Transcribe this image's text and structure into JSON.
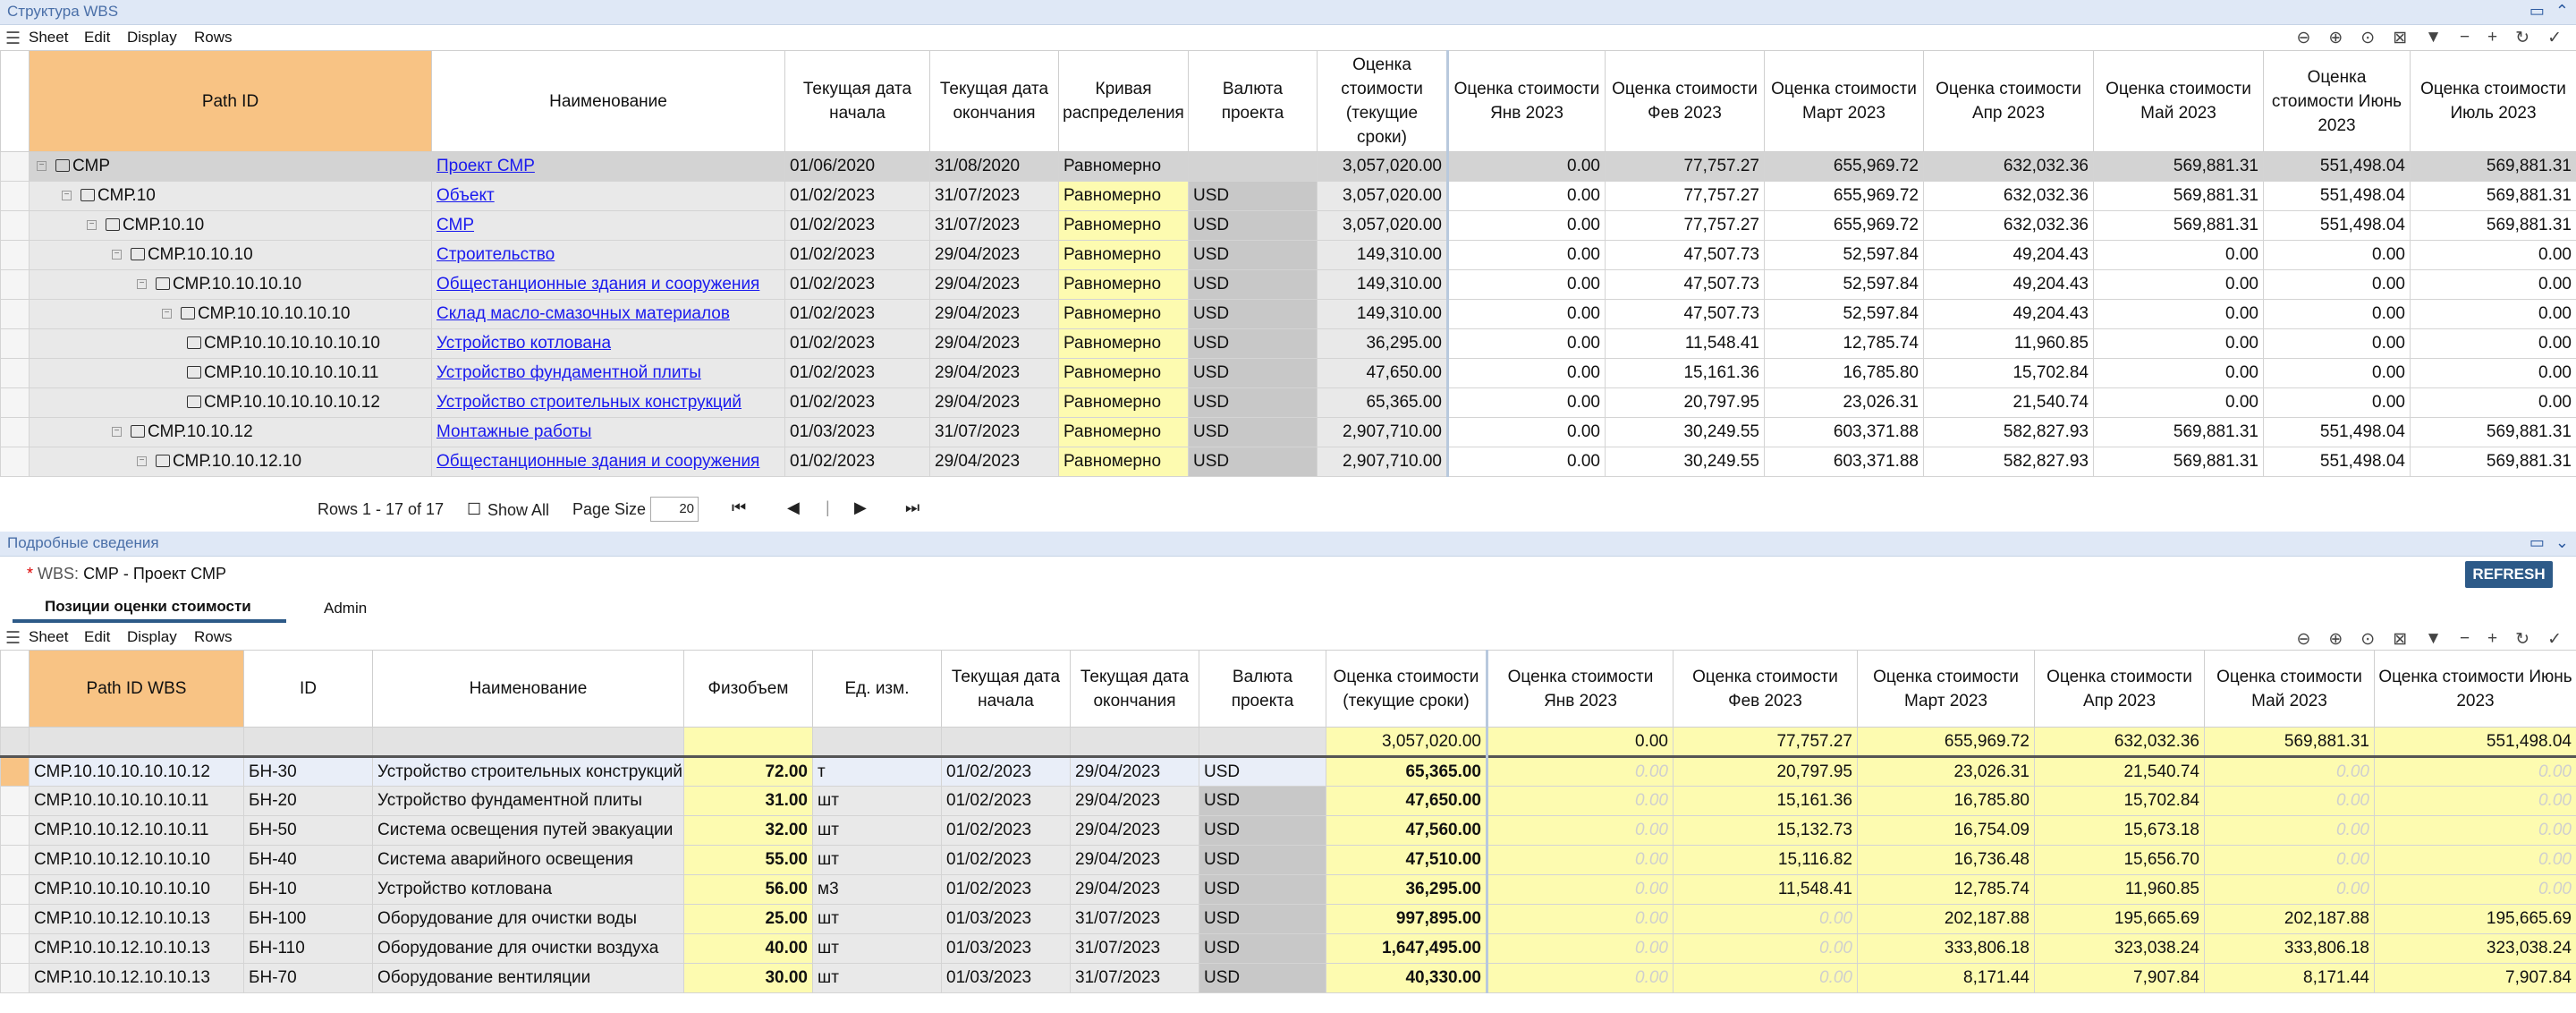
{
  "top_panel": {
    "title": "Структура WBS"
  },
  "menu": {
    "sheet": "Sheet",
    "edit": "Edit",
    "display": "Display",
    "rows": "Rows"
  },
  "top_grid": {
    "headers": [
      "Path ID",
      "Наименование",
      "Текущая дата начала",
      "Текущая дата окончания",
      "Кривая распределения",
      "Валюта проекта",
      "Оценка стоимости (текущие сроки)",
      "Оценка стоимости Янв 2023",
      "Оценка стоимости Фев 2023",
      "Оценка стоимости Март 2023",
      "Оценка стоимости Апр 2023",
      "Оценка стоимости Май 2023",
      "Оценка стоимости Июнь 2023",
      "Оценка стоимости Июль 2023"
    ],
    "rows": [
      {
        "path": "СМР",
        "name": "Проект СМР",
        "start": "01/06/2020",
        "end": "31/08/2020",
        "curve": "Равномерно",
        "cur": "",
        "total": "3,057,020.00",
        "m1": "0.00",
        "m2": "77,757.27",
        "m3": "655,969.72",
        "m4": "632,032.36",
        "m5": "569,881.31",
        "m6": "551,498.04",
        "m7": "569,881.31"
      },
      {
        "path": "СМР.10",
        "name": "Объект",
        "start": "01/02/2023",
        "end": "31/07/2023",
        "curve": "Равномерно",
        "cur": "USD",
        "total": "3,057,020.00",
        "m1": "0.00",
        "m2": "77,757.27",
        "m3": "655,969.72",
        "m4": "632,032.36",
        "m5": "569,881.31",
        "m6": "551,498.04",
        "m7": "569,881.31"
      },
      {
        "path": "СМР.10.10",
        "name": "СМР",
        "start": "01/02/2023",
        "end": "31/07/2023",
        "curve": "Равномерно",
        "cur": "USD",
        "total": "3,057,020.00",
        "m1": "0.00",
        "m2": "77,757.27",
        "m3": "655,969.72",
        "m4": "632,032.36",
        "m5": "569,881.31",
        "m6": "551,498.04",
        "m7": "569,881.31"
      },
      {
        "path": "СМР.10.10.10",
        "name": "Строительство",
        "start": "01/02/2023",
        "end": "29/04/2023",
        "curve": "Равномерно",
        "cur": "USD",
        "total": "149,310.00",
        "m1": "0.00",
        "m2": "47,507.73",
        "m3": "52,597.84",
        "m4": "49,204.43",
        "m5": "0.00",
        "m6": "0.00",
        "m7": "0.00"
      },
      {
        "path": "СМР.10.10.10.10",
        "name": "Общестанционные здания и сооружения",
        "start": "01/02/2023",
        "end": "29/04/2023",
        "curve": "Равномерно",
        "cur": "USD",
        "total": "149,310.00",
        "m1": "0.00",
        "m2": "47,507.73",
        "m3": "52,597.84",
        "m4": "49,204.43",
        "m5": "0.00",
        "m6": "0.00",
        "m7": "0.00"
      },
      {
        "path": "СМР.10.10.10.10.10",
        "name": "Склад масло-смазочных материалов",
        "start": "01/02/2023",
        "end": "29/04/2023",
        "curve": "Равномерно",
        "cur": "USD",
        "total": "149,310.00",
        "m1": "0.00",
        "m2": "47,507.73",
        "m3": "52,597.84",
        "m4": "49,204.43",
        "m5": "0.00",
        "m6": "0.00",
        "m7": "0.00"
      },
      {
        "path": "СМР.10.10.10.10.10.10",
        "name": "Устройство котлована",
        "start": "01/02/2023",
        "end": "29/04/2023",
        "curve": "Равномерно",
        "cur": "USD",
        "total": "36,295.00",
        "m1": "0.00",
        "m2": "11,548.41",
        "m3": "12,785.74",
        "m4": "11,960.85",
        "m5": "0.00",
        "m6": "0.00",
        "m7": "0.00"
      },
      {
        "path": "СМР.10.10.10.10.10.11",
        "name": "Устройство фундаментной плиты",
        "start": "01/02/2023",
        "end": "29/04/2023",
        "curve": "Равномерно",
        "cur": "USD",
        "total": "47,650.00",
        "m1": "0.00",
        "m2": "15,161.36",
        "m3": "16,785.80",
        "m4": "15,702.84",
        "m5": "0.00",
        "m6": "0.00",
        "m7": "0.00"
      },
      {
        "path": "СМР.10.10.10.10.10.12",
        "name": "Устройство строительных конструкций",
        "start": "01/02/2023",
        "end": "29/04/2023",
        "curve": "Равномерно",
        "cur": "USD",
        "total": "65,365.00",
        "m1": "0.00",
        "m2": "20,797.95",
        "m3": "23,026.31",
        "m4": "21,540.74",
        "m5": "0.00",
        "m6": "0.00",
        "m7": "0.00"
      },
      {
        "path": "СМР.10.10.12",
        "name": "Монтажные работы",
        "start": "01/03/2023",
        "end": "31/07/2023",
        "curve": "Равномерно",
        "cur": "USD",
        "total": "2,907,710.00",
        "m1": "0.00",
        "m2": "30,249.55",
        "m3": "603,371.88",
        "m4": "582,827.93",
        "m5": "569,881.31",
        "m6": "551,498.04",
        "m7": "569,881.31"
      },
      {
        "path": "СМР.10.10.12.10",
        "name": "Общестанционные здания и сооружения",
        "start": "01/02/2023",
        "end": "29/04/2023",
        "curve": "Равномерно",
        "cur": "USD",
        "total": "2,907,710.00",
        "m1": "0.00",
        "m2": "30,249.55",
        "m3": "603,371.88",
        "m4": "582,827.93",
        "m5": "569,881.31",
        "m6": "551,498.04",
        "m7": "569,881.31"
      }
    ]
  },
  "pager": {
    "rows_text": "Rows 1 - 17 of 17",
    "show_all": "Show All",
    "page_size_label": "Page Size",
    "page_size": "20"
  },
  "bottom_panel": {
    "title": "Подробные сведения",
    "wbs_label": "WBS:",
    "wbs_value": "СМР - Проект СМР",
    "refresh": "REFRESH",
    "tab1": "Позиции оценки стоимости",
    "tab2": "Admin"
  },
  "bottom_grid": {
    "headers": [
      "Path ID WBS",
      "ID",
      "Наименование",
      "Физобъем",
      "Ед. изм.",
      "Текущая дата начала",
      "Текущая дата окончания",
      "Валюта проекта",
      "Оценка стоимости (текущие сроки)",
      "Оценка стоимости Янв 2023",
      "Оценка стоимости Фев 2023",
      "Оценка стоимости Март 2023",
      "Оценка стоимости Апр 2023",
      "Оценка стоимости Май 2023",
      "Оценка стоимости Июнь 2023"
    ],
    "totals": {
      "total": "3,057,020.00",
      "m1": "0.00",
      "m2": "77,757.27",
      "m3": "655,969.72",
      "m4": "632,032.36",
      "m5": "569,881.31",
      "m6": "551,498.04"
    },
    "rows": [
      {
        "path": "СМР.10.10.10.10.10.12",
        "id": "БН-30",
        "name": "Устройство строительных конструкций",
        "qty": "72.00",
        "unit": "т",
        "start": "01/02/2023",
        "end": "29/04/2023",
        "cur": "USD",
        "total": "65,365.00",
        "m1": "0.00",
        "m2": "20,797.95",
        "m3": "23,026.31",
        "m4": "21,540.74",
        "m5": "0.00",
        "m6": "0.00"
      },
      {
        "path": "СМР.10.10.10.10.10.11",
        "id": "БН-20",
        "name": "Устройство фундаментной плиты",
        "qty": "31.00",
        "unit": "шт",
        "start": "01/02/2023",
        "end": "29/04/2023",
        "cur": "USD",
        "total": "47,650.00",
        "m1": "0.00",
        "m2": "15,161.36",
        "m3": "16,785.80",
        "m4": "15,702.84",
        "m5": "0.00",
        "m6": "0.00"
      },
      {
        "path": "СМР.10.10.12.10.10.11",
        "id": "БН-50",
        "name": "Система освещения путей эвакуации",
        "qty": "32.00",
        "unit": "шт",
        "start": "01/02/2023",
        "end": "29/04/2023",
        "cur": "USD",
        "total": "47,560.00",
        "m1": "0.00",
        "m2": "15,132.73",
        "m3": "16,754.09",
        "m4": "15,673.18",
        "m5": "0.00",
        "m6": "0.00"
      },
      {
        "path": "СМР.10.10.12.10.10.10",
        "id": "БН-40",
        "name": "Система аварийного освещения",
        "qty": "55.00",
        "unit": "шт",
        "start": "01/02/2023",
        "end": "29/04/2023",
        "cur": "USD",
        "total": "47,510.00",
        "m1": "0.00",
        "m2": "15,116.82",
        "m3": "16,736.48",
        "m4": "15,656.70",
        "m5": "0.00",
        "m6": "0.00"
      },
      {
        "path": "СМР.10.10.10.10.10.10",
        "id": "БН-10",
        "name": "Устройство котлована",
        "qty": "56.00",
        "unit": "м3",
        "start": "01/02/2023",
        "end": "29/04/2023",
        "cur": "USD",
        "total": "36,295.00",
        "m1": "0.00",
        "m2": "11,548.41",
        "m3": "12,785.74",
        "m4": "11,960.85",
        "m5": "0.00",
        "m6": "0.00"
      },
      {
        "path": "СМР.10.10.12.10.10.13",
        "id": "БН-100",
        "name": "Оборудование для очистки воды",
        "qty": "25.00",
        "unit": "шт",
        "start": "01/03/2023",
        "end": "31/07/2023",
        "cur": "USD",
        "total": "997,895.00",
        "m1": "0.00",
        "m2": "0.00",
        "m3": "202,187.88",
        "m4": "195,665.69",
        "m5": "202,187.88",
        "m6": "195,665.69"
      },
      {
        "path": "СМР.10.10.12.10.10.13",
        "id": "БН-110",
        "name": "Оборудование для очистки воздуха",
        "qty": "40.00",
        "unit": "шт",
        "start": "01/03/2023",
        "end": "31/07/2023",
        "cur": "USD",
        "total": "1,647,495.00",
        "m1": "0.00",
        "m2": "0.00",
        "m3": "333,806.18",
        "m4": "323,038.24",
        "m5": "333,806.18",
        "m6": "323,038.24"
      },
      {
        "path": "СМР.10.10.12.10.10.13",
        "id": "БН-70",
        "name": "Оборудование вентиляции",
        "qty": "30.00",
        "unit": "шт",
        "start": "01/03/2023",
        "end": "31/07/2023",
        "cur": "USD",
        "total": "40,330.00",
        "m1": "0.00",
        "m2": "0.00",
        "m3": "8,171.44",
        "m4": "7,907.84",
        "m5": "8,171.44",
        "m6": "7,907.84"
      }
    ]
  }
}
